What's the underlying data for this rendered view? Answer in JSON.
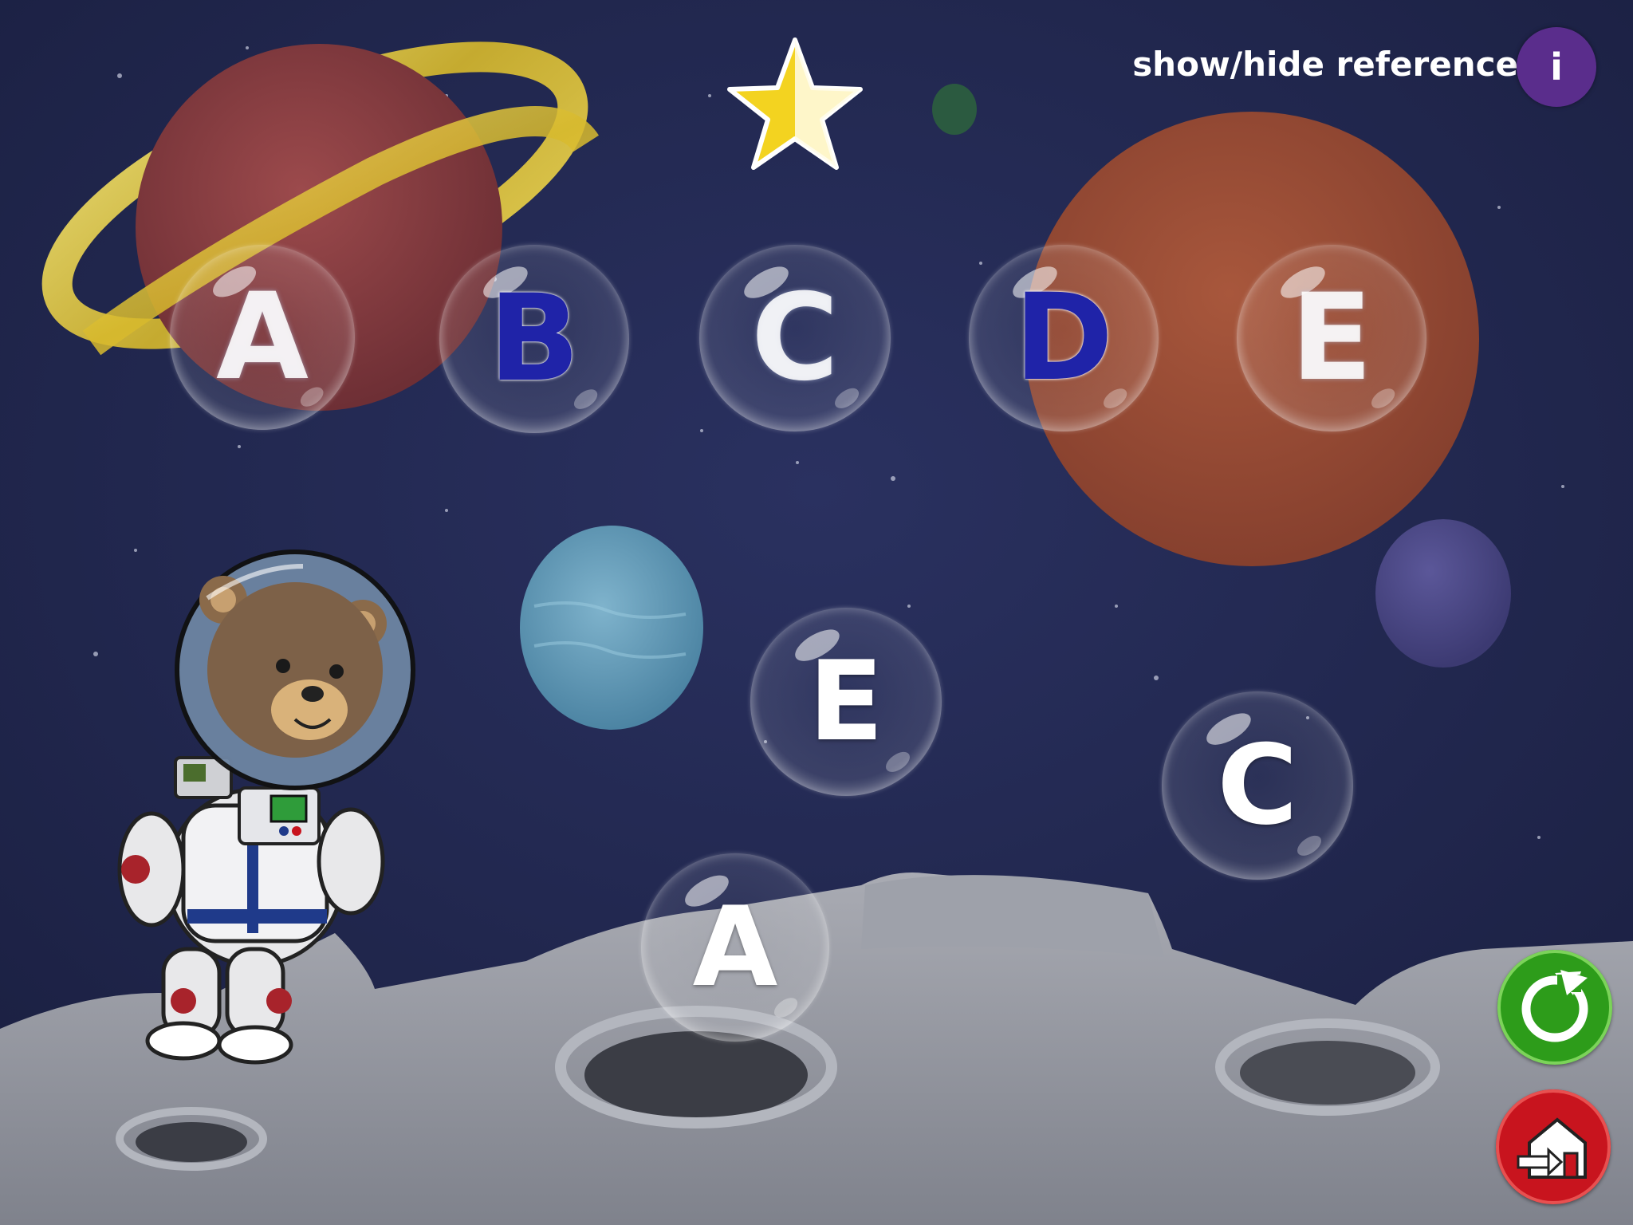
{
  "header": {
    "reference_label": "show/hide reference",
    "info_label": "i"
  },
  "reference_letters": [
    {
      "letter": "A",
      "state": "empty"
    },
    {
      "letter": "B",
      "state": "filled"
    },
    {
      "letter": "C",
      "state": "empty"
    },
    {
      "letter": "D",
      "state": "filled"
    },
    {
      "letter": "E",
      "state": "empty"
    }
  ],
  "floating_letters": [
    "E",
    "C",
    "A"
  ],
  "icons": {
    "star": "star-icon",
    "replay": "replay-icon",
    "home": "exit-home-icon"
  },
  "colors": {
    "sky": "#1f2548",
    "filled_letter": "#1f23a8",
    "info_button": "#5a2d8c",
    "replay_button": "#2d9c1a",
    "home_button": "#c8141e",
    "star": "#f3d320"
  }
}
